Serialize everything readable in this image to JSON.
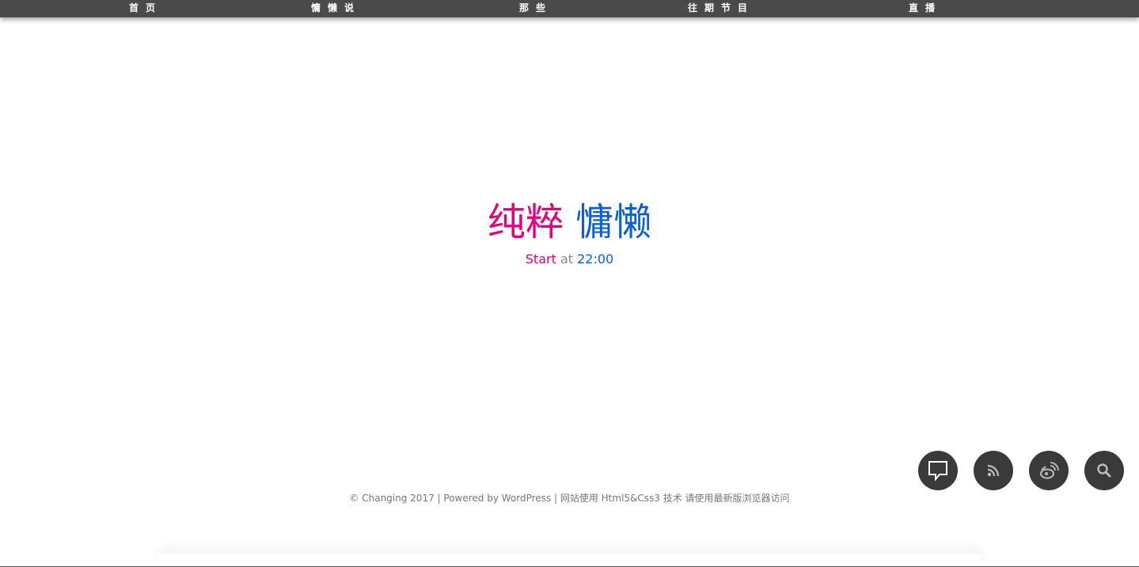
{
  "nav": {
    "items": [
      {
        "label": "首页"
      },
      {
        "label": "慵懒说"
      },
      {
        "label": "那些"
      },
      {
        "label": "往期节目"
      },
      {
        "label": "直播"
      }
    ]
  },
  "hero": {
    "title_part1": "纯粹",
    "title_part2": "慵懒",
    "sub_start": "Start",
    "sub_at": "at",
    "sub_time": "22:00"
  },
  "footer": {
    "text": "© Changing 2017 | Powered by WordPress | 网站使用 Html5&Css3 技术 请使用最新版浏览器访问"
  },
  "buttons": [
    {
      "icon": "comment-icon"
    },
    {
      "icon": "rss-icon"
    },
    {
      "icon": "weibo-icon"
    },
    {
      "icon": "search-icon"
    }
  ],
  "colors": {
    "nav_bg": "#4a4a4a",
    "accent_pink": "#e6007e",
    "accent_blue": "#0b5ed7",
    "button_bg": "#3a3a3a"
  }
}
